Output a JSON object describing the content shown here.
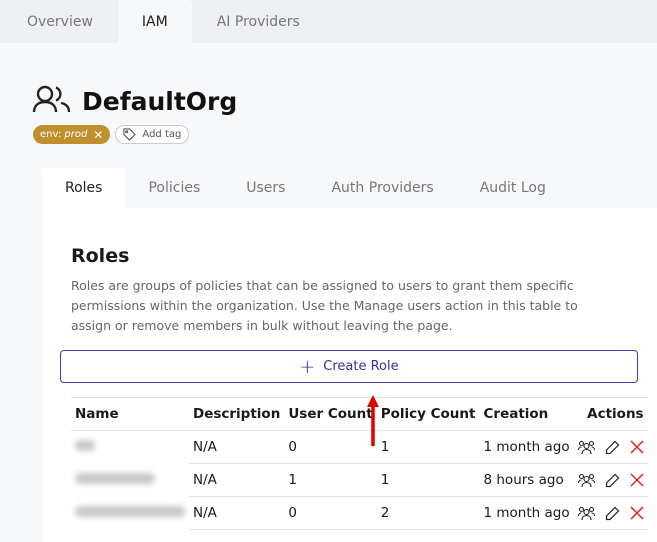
{
  "top_tabs": [
    {
      "label": "Overview"
    },
    {
      "label": "IAM"
    },
    {
      "label": "AI Providers"
    }
  ],
  "org": {
    "name": "DefaultOrg",
    "tag_key": "env:",
    "tag_value": "prod",
    "add_tag": "Add tag"
  },
  "sub_tabs": [
    {
      "label": "Roles"
    },
    {
      "label": "Policies"
    },
    {
      "label": "Users"
    },
    {
      "label": "Auth Providers"
    },
    {
      "label": "Audit Log"
    }
  ],
  "roles": {
    "title": "Roles",
    "description": "Roles are groups of policies that can be assigned to users to grant them specific permissions within the organization. Use the Manage users action in this table to assign or remove members in bulk without leaving the page.",
    "create_label": "Create Role",
    "columns": [
      "Name",
      "Description",
      "User Count",
      "Policy Count",
      "Creation",
      "Actions"
    ],
    "rows": [
      {
        "description": "N/A",
        "user_count": "0",
        "policy_count": "1",
        "creation": "1 month ago"
      },
      {
        "description": "N/A",
        "user_count": "1",
        "policy_count": "1",
        "creation": "8 hours ago"
      },
      {
        "description": "N/A",
        "user_count": "0",
        "policy_count": "2",
        "creation": "1 month ago"
      }
    ]
  },
  "colors": {
    "accent": "#4a3aa8",
    "tag": "#c0902e",
    "delete": "#e02020",
    "annotation": "#e00000"
  }
}
